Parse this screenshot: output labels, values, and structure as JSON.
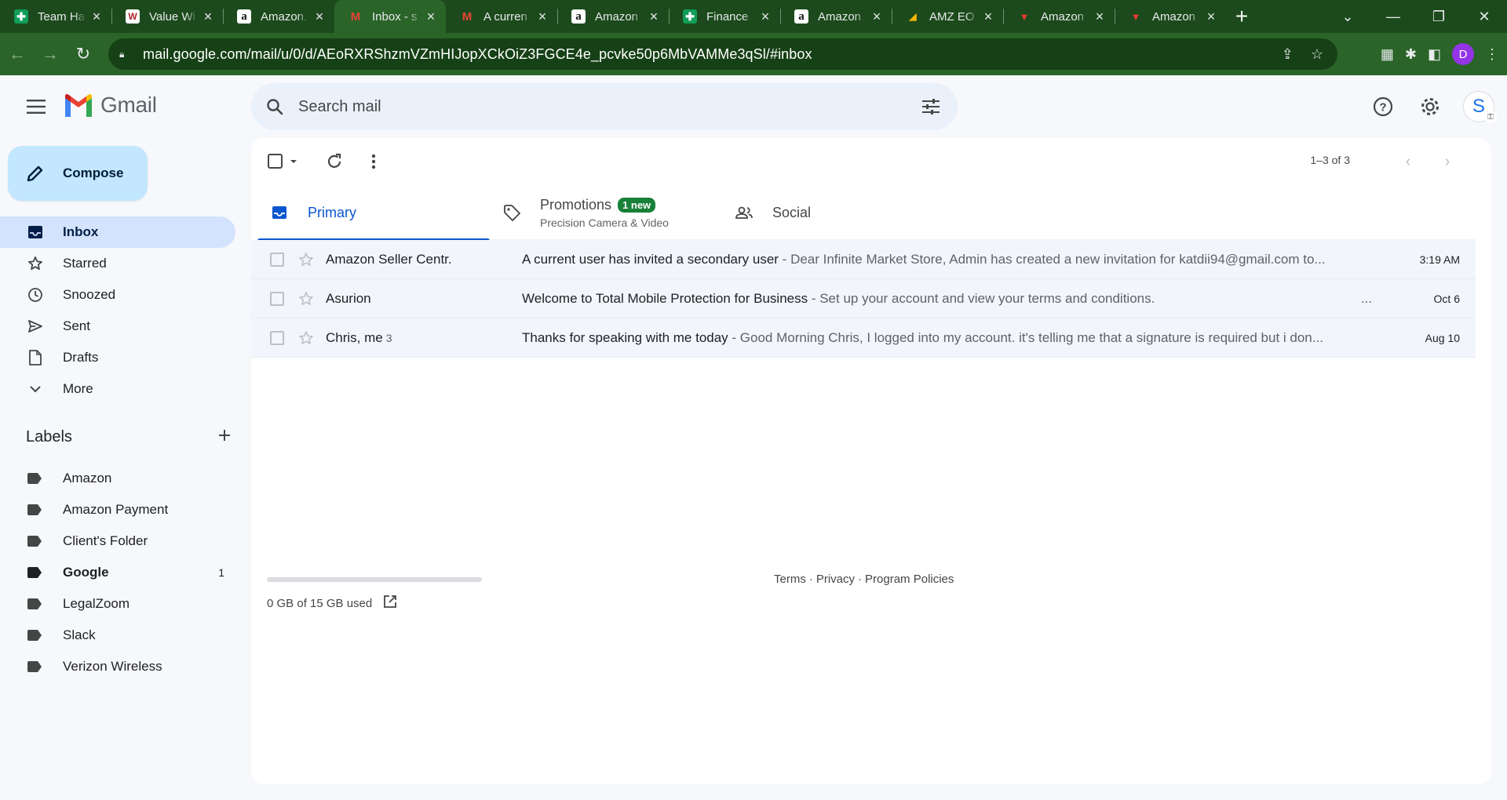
{
  "browser": {
    "tabs": [
      {
        "favicon": "sheets-icon",
        "title": "Team Ha",
        "active": false
      },
      {
        "favicon": "wolf-icon",
        "title": "Value Wi",
        "active": false
      },
      {
        "favicon": "amazon-icon",
        "title": "Amazon.",
        "active": false
      },
      {
        "favicon": "gmail-icon",
        "title": "Inbox - s",
        "active": true
      },
      {
        "favicon": "gmail-icon",
        "title": "A curren",
        "active": false
      },
      {
        "favicon": "amazon-icon",
        "title": "Amazon",
        "active": false
      },
      {
        "favicon": "sheets-icon",
        "title": "Finance",
        "active": false
      },
      {
        "favicon": "amazon-icon",
        "title": "Amazon",
        "active": false
      },
      {
        "favicon": "amz-icon",
        "title": "AMZ EO",
        "active": false
      },
      {
        "favicon": "red-logo-icon",
        "title": "Amazon",
        "active": false
      },
      {
        "favicon": "red-logo-icon",
        "title": "Amazon",
        "active": false
      }
    ],
    "url": "mail.google.com/mail/u/0/d/AEoRXRShzmVZmHIJopXCkOiZ3FGCE4e_pcvke50p6MbVAMMe3qSl/#inbox",
    "profile_initial": "D"
  },
  "app": {
    "name": "Gmail",
    "search_placeholder": "Search mail",
    "account_initial": "S"
  },
  "sidebar": {
    "compose_label": "Compose",
    "items": [
      {
        "label": "Inbox",
        "icon": "inbox-icon",
        "active": true
      },
      {
        "label": "Starred",
        "icon": "star-icon",
        "active": false
      },
      {
        "label": "Snoozed",
        "icon": "clock-icon",
        "active": false
      },
      {
        "label": "Sent",
        "icon": "send-icon",
        "active": false
      },
      {
        "label": "Drafts",
        "icon": "draft-icon",
        "active": false
      },
      {
        "label": "More",
        "icon": "chevron-down-icon",
        "active": false
      }
    ],
    "labels_title": "Labels",
    "labels": [
      {
        "label": "Amazon",
        "count": "",
        "bold": false
      },
      {
        "label": "Amazon Payment",
        "count": "",
        "bold": false
      },
      {
        "label": "Client's Folder",
        "count": "",
        "bold": false
      },
      {
        "label": "Google",
        "count": "1",
        "bold": true
      },
      {
        "label": "LegalZoom",
        "count": "",
        "bold": false
      },
      {
        "label": "Slack",
        "count": "",
        "bold": false
      },
      {
        "label": "Verizon Wireless",
        "count": "",
        "bold": false
      }
    ]
  },
  "toolbar": {
    "pager_text": "1–3 of 3"
  },
  "categories": [
    {
      "name": "Primary",
      "icon": "inbox-tab-icon",
      "active": true,
      "badge": "",
      "sub": ""
    },
    {
      "name": "Promotions",
      "icon": "tag-icon",
      "active": false,
      "badge": "1 new",
      "sub": "Precision Camera & Video"
    },
    {
      "name": "Social",
      "icon": "people-icon",
      "active": false,
      "badge": "",
      "sub": ""
    }
  ],
  "emails": [
    {
      "sender": "Amazon Seller Centr.",
      "count": "",
      "subject": "A current user has invited a secondary user",
      "separator": " - ",
      "snippet": "Dear Infinite Market Store, Admin has created a new invitation for katdii94@gmail.com to...",
      "date": "3:19 AM",
      "dots": ""
    },
    {
      "sender": "Asurion",
      "count": "",
      "subject": "Welcome to Total Mobile Protection for Business",
      "separator": " - ",
      "snippet": "Set up your account and view your terms and conditions.",
      "date": "Oct 6",
      "dots": "..."
    },
    {
      "sender": "Chris, me",
      "count": "3",
      "subject": "Thanks for speaking with me today",
      "separator": " - ",
      "snippet": "Good Morning Chris, I logged into my account. it's telling me that a signature is required but i don...",
      "date": "Aug 10",
      "dots": ""
    }
  ],
  "footer": {
    "storage_text": "0 GB of 15 GB used",
    "storage_used_fraction": 0,
    "terms": "Terms",
    "privacy": "Privacy",
    "policies": "Program Policies",
    "dot": "·"
  },
  "colors": {
    "chrome_frame": "#1c4a1c",
    "chrome_toolbar": "#2a6428",
    "compose_bg": "#c2e7ff",
    "active_nav_bg": "#d3e3fd",
    "primary_blue": "#0b57d0",
    "badge_green": "#188038"
  }
}
